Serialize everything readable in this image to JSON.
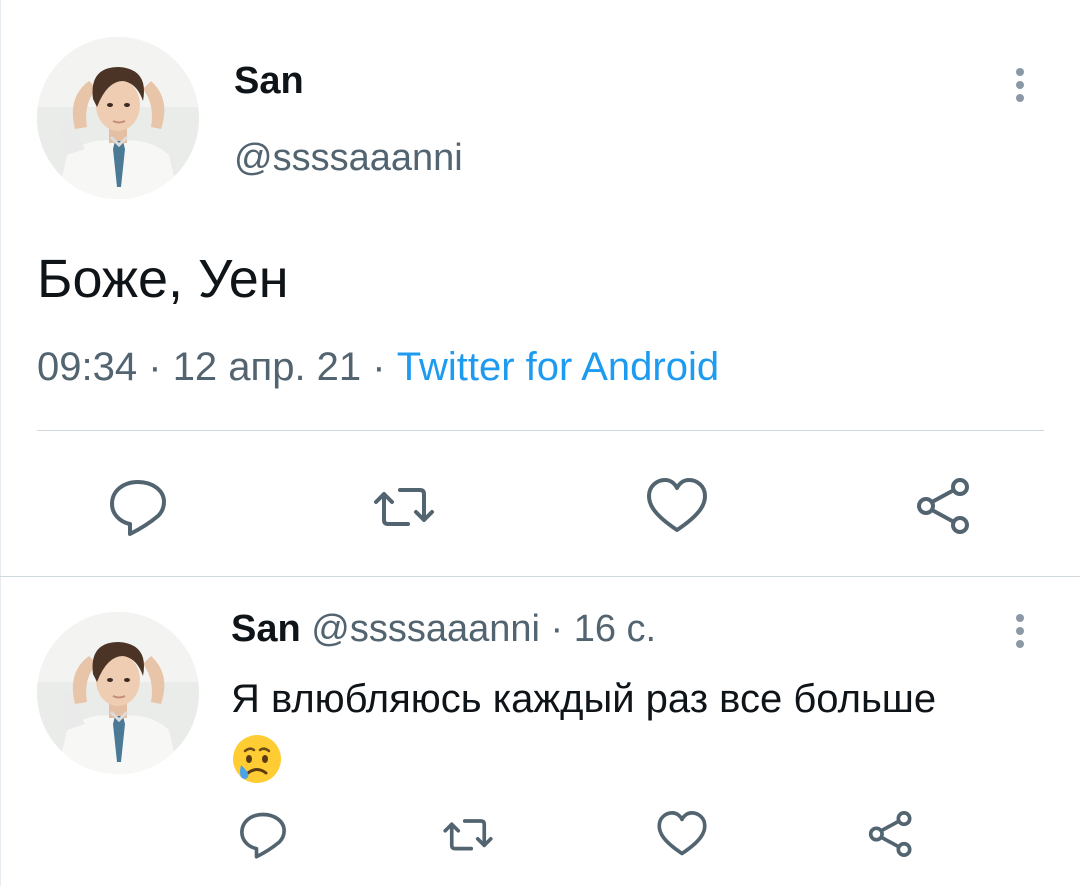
{
  "main_tweet": {
    "display_name": "San",
    "handle": "@ssssaaanni",
    "text": "Боже, Уен",
    "time": "09:34",
    "date": "12 апр. 21",
    "separator": "·",
    "source": "Twitter for Android",
    "actions": [
      "reply-icon",
      "retweet-icon",
      "like-icon",
      "share-icon"
    ]
  },
  "reply": {
    "display_name": "San",
    "handle": "@ssssaaanni",
    "separator": "·",
    "age": "16 с.",
    "text": "Я влюбляюсь каждый раз все больше",
    "emoji": "crying-face-emoji",
    "actions": [
      "reply-icon",
      "retweet-icon",
      "like-icon",
      "share-icon"
    ]
  },
  "colors": {
    "text": "#0f1419",
    "secondary": "#536471",
    "link": "#1d9bf0",
    "divider": "#cfd9de"
  }
}
